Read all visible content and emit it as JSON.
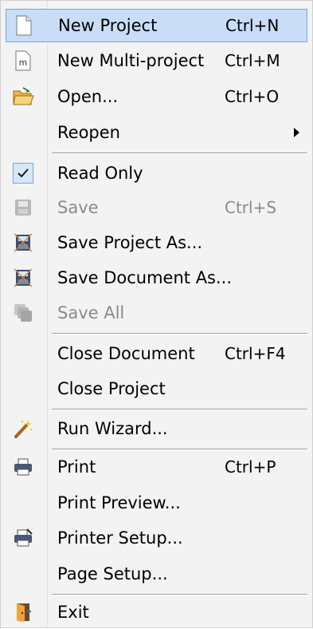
{
  "menu": {
    "items": [
      {
        "label": "New Project",
        "shortcut": "Ctrl+N",
        "icon": "new-project-icon"
      },
      {
        "label": "New Multi-project",
        "shortcut": "Ctrl+M",
        "icon": "new-multi-project-icon"
      },
      {
        "label": "Open...",
        "shortcut": "Ctrl+O",
        "icon": "open-folder-icon"
      },
      {
        "label": "Reopen",
        "shortcut": "",
        "icon": "submenu-arrow-icon"
      },
      {
        "label": "Read Only",
        "shortcut": "",
        "icon": "checkmark-icon"
      },
      {
        "label": "Save",
        "shortcut": "Ctrl+S",
        "icon": "save-icon"
      },
      {
        "label": "Save Project As...",
        "shortcut": "",
        "icon": "save-as-icon"
      },
      {
        "label": "Save Document As...",
        "shortcut": "",
        "icon": "save-as-icon"
      },
      {
        "label": "Save All",
        "shortcut": "",
        "icon": "save-all-icon"
      },
      {
        "label": "Close Document",
        "shortcut": "Ctrl+F4",
        "icon": ""
      },
      {
        "label": "Close Project",
        "shortcut": "",
        "icon": ""
      },
      {
        "label": "Run Wizard...",
        "shortcut": "",
        "icon": "wizard-wand-icon"
      },
      {
        "label": "Print",
        "shortcut": "Ctrl+P",
        "icon": "printer-icon"
      },
      {
        "label": "Print Preview...",
        "shortcut": "",
        "icon": ""
      },
      {
        "label": "Printer Setup...",
        "shortcut": "",
        "icon": "printer-setup-icon"
      },
      {
        "label": "Page Setup...",
        "shortcut": "",
        "icon": ""
      },
      {
        "label": "Exit",
        "shortcut": "",
        "icon": "exit-door-icon"
      }
    ],
    "highlighted": "New Project",
    "disabled": [
      "Save",
      "Save All"
    ],
    "checked": [
      "Read Only"
    ]
  },
  "colors": {
    "menu_bg": "#f3f3f3",
    "highlight_bg": "#c9ddf6",
    "highlight_border": "#7ea4d7",
    "disabled_text": "#8a8a8a"
  }
}
